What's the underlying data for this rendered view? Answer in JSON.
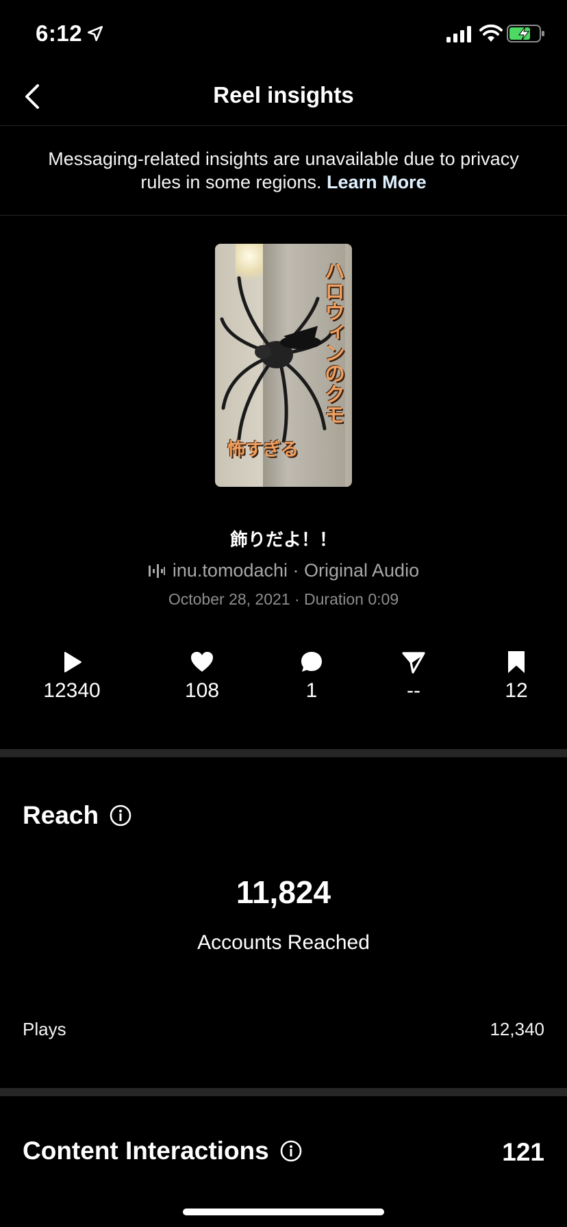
{
  "status": {
    "time": "6:12"
  },
  "nav": {
    "title": "Reel insights"
  },
  "notice": {
    "text": "Messaging-related insights are unavailable due to privacy rules in some regions.",
    "link": "Learn More"
  },
  "thumbnail": {
    "vertical_text": "ハロウィンのクモ",
    "bottom_text": "怖すぎる"
  },
  "reel": {
    "caption": "飾りだよ！！",
    "audio": "inu.tomodachi · Original Audio",
    "meta": "October 28, 2021 · Duration 0:09"
  },
  "stats": {
    "plays": "12340",
    "likes": "108",
    "comments": "1",
    "shares": "--",
    "saves": "12"
  },
  "reach": {
    "title": "Reach",
    "number": "11,824",
    "label": "Accounts Reached",
    "plays_label": "Plays",
    "plays_value": "12,340"
  },
  "content_interactions": {
    "title": "Content Interactions",
    "value": "121"
  },
  "colors": {
    "background": "#000000",
    "divider": "#262626",
    "secondary_text": "#a8a8a8",
    "battery_green": "#4cd964"
  }
}
